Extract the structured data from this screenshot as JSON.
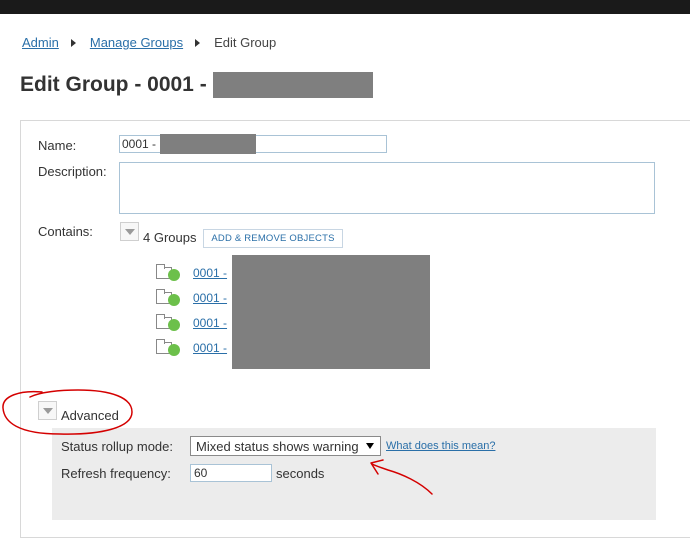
{
  "breadcrumb": {
    "admin": "Admin",
    "manage_groups": "Manage Groups",
    "current": "Edit Group"
  },
  "page": {
    "title": "Edit Group - 0001 -"
  },
  "form": {
    "name_label": "Name:",
    "name_value": "0001 -",
    "description_label": "Description:",
    "description_value": "",
    "contains_label": "Contains:",
    "groups_count": "4 Groups",
    "add_remove_label": "ADD & REMOVE OBJECTS"
  },
  "groups": [
    {
      "name": "0001 -",
      "status": "green"
    },
    {
      "name": "0001 -",
      "status": "green"
    },
    {
      "name": "0001 -",
      "status": "green"
    },
    {
      "name": "0001 -",
      "status": "green"
    }
  ],
  "advanced": {
    "toggle_label": "Advanced",
    "status_rollup_label": "Status rollup mode:",
    "status_rollup_value": "Mixed status shows warning",
    "help_link": "What does this mean?",
    "refresh_label": "Refresh frequency:",
    "refresh_value": "60",
    "refresh_unit": "seconds"
  },
  "colors": {
    "link": "#2a6fa8",
    "status_ok": "#6cc04a",
    "annotation": "#d40000",
    "redaction": "#7f7f7f"
  }
}
